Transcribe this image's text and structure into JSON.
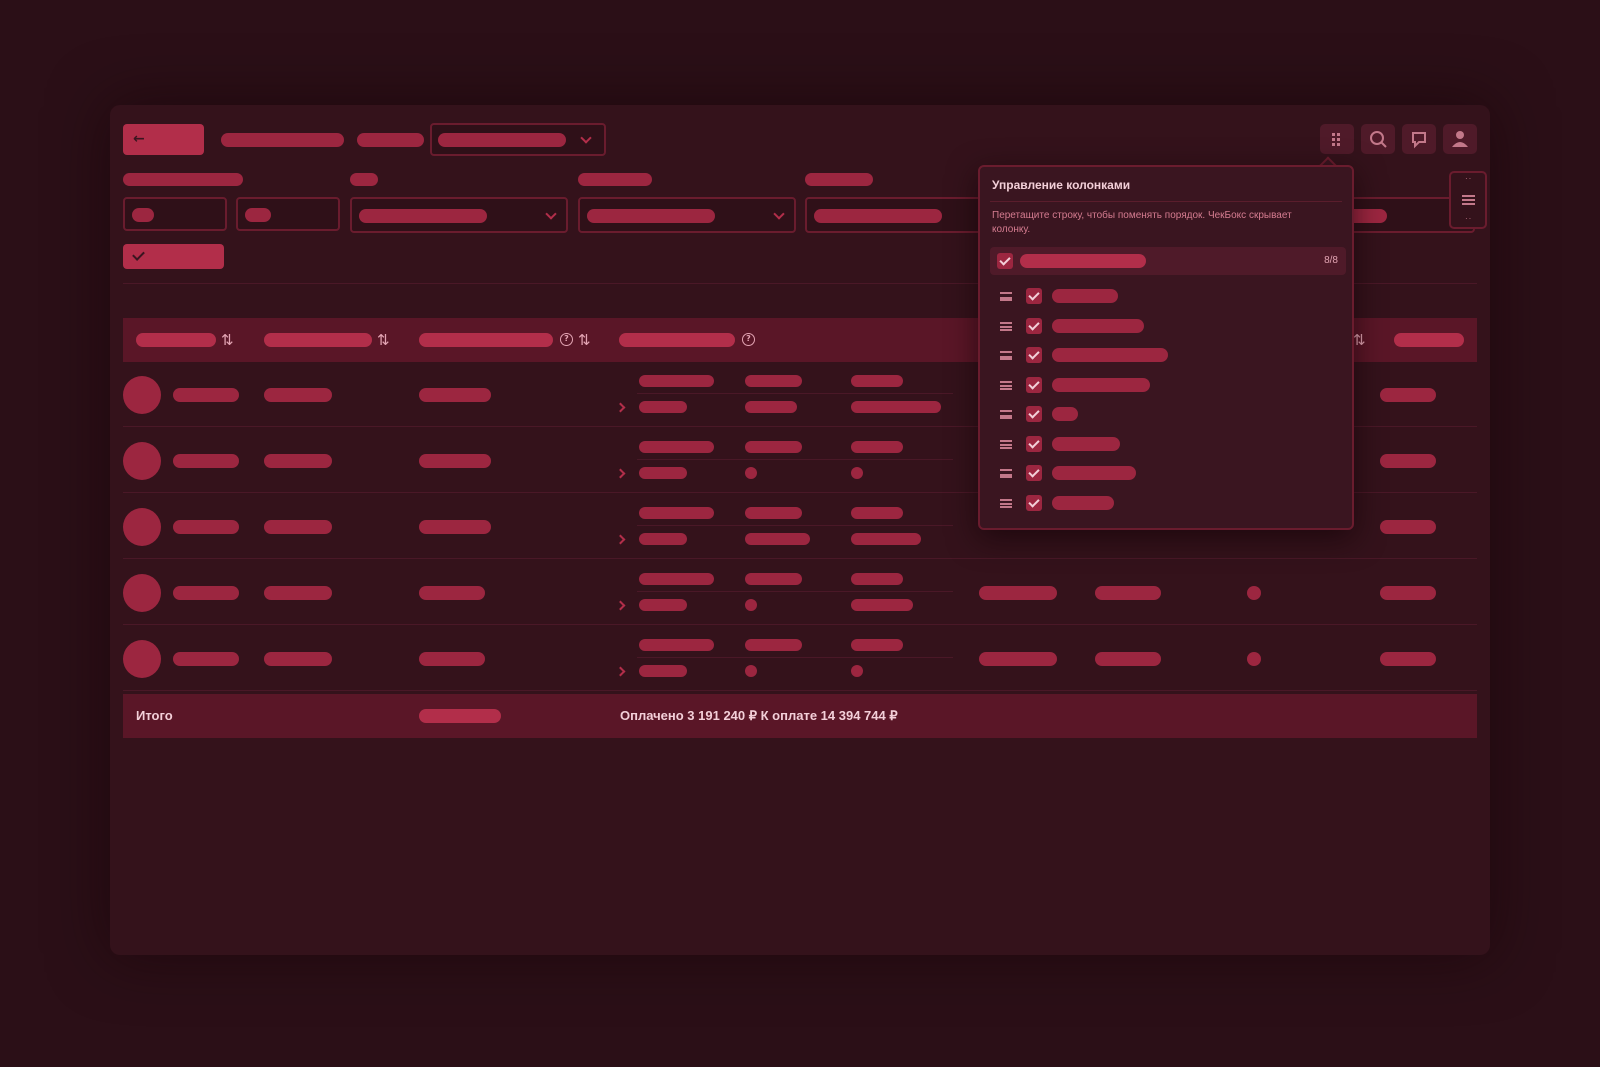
{
  "header": {
    "back_icon": "arrow-left-icon",
    "icons": [
      "grid-icon",
      "search-icon",
      "notification-icon",
      "user-icon"
    ]
  },
  "column_manager": {
    "title": "Управление колонками",
    "description": "Перетащите строку, чтобы поменять порядок. ЧекБокс скрывает колонку.",
    "count": "8/8",
    "items_checked": [
      true,
      true,
      true,
      true,
      true,
      true,
      true,
      true
    ]
  },
  "table": {
    "row_count": 5
  },
  "footer": {
    "label": "Итого",
    "summary": "Оплачено 3 191 240 ₽ К оплате 14 394 744 ₽"
  },
  "colors": {
    "background": "#2b0f17",
    "accent": "#b22e4a",
    "header_bar": "#5a1627"
  }
}
